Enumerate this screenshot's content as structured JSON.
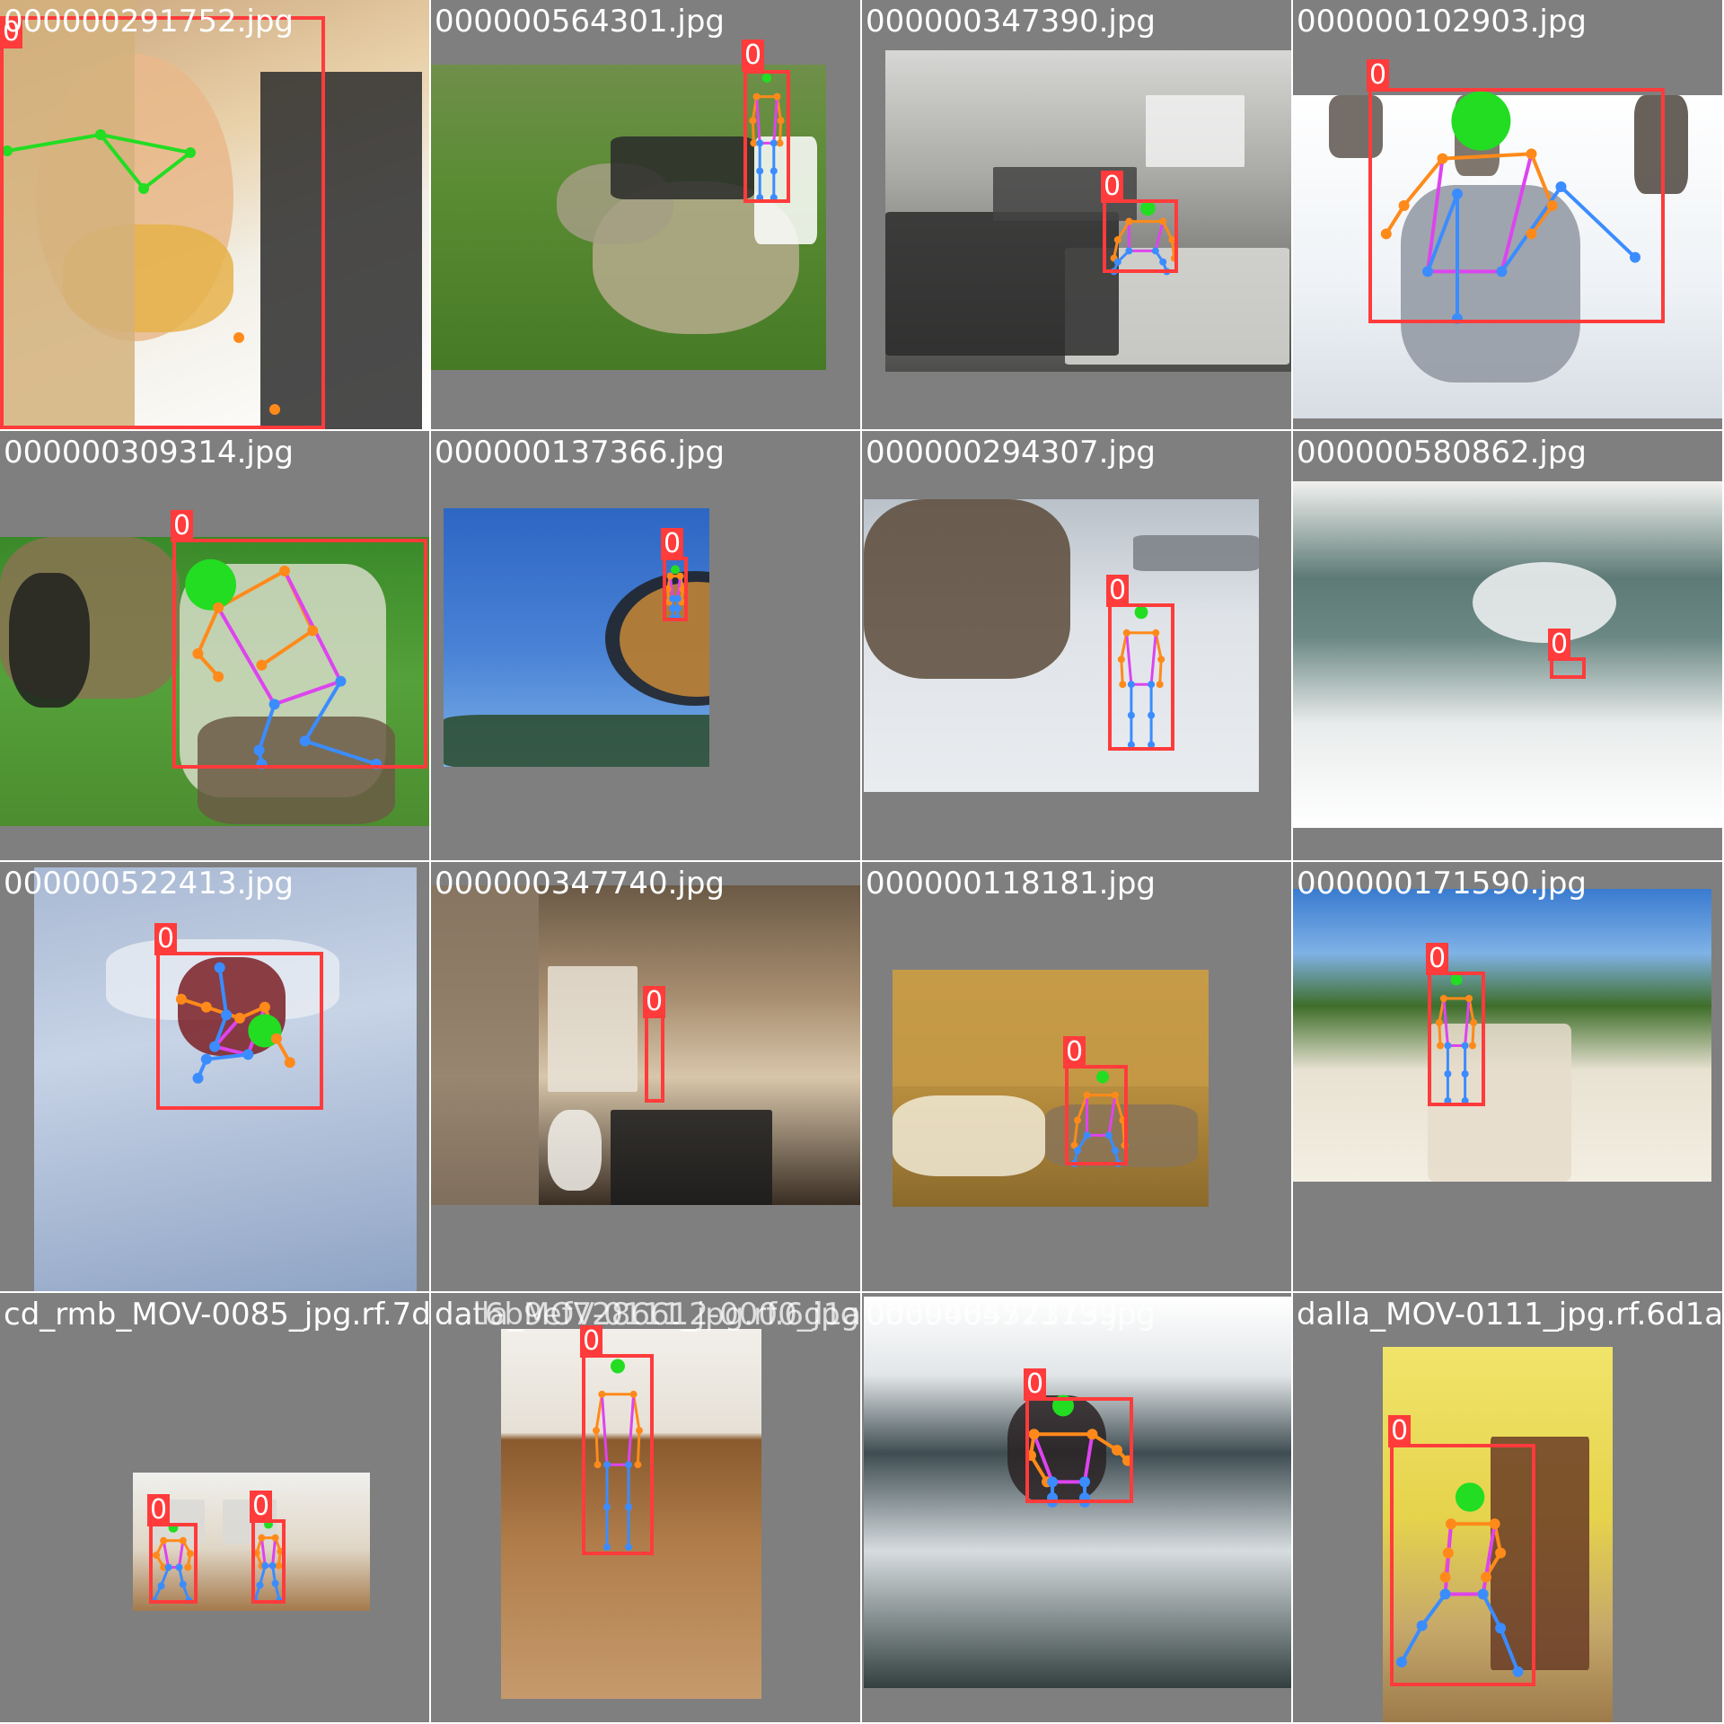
{
  "colors": {
    "box": "#ff3b3b",
    "label_bg": "#ff3b3b",
    "label_text": "#ffffff",
    "face_line": "#22dd22",
    "arm_line": "#ff8a1a",
    "torso_line": "#dd44ee",
    "leg_line": "#3b8cff",
    "letterbox": "#7f7f7f"
  },
  "tiles": [
    {
      "filename": "000000291752.jpg",
      "photo_theme": "child-eating-pizza",
      "detections": [
        {
          "class_label": "0"
        }
      ]
    },
    {
      "filename": "000000564301.jpg",
      "photo_theme": "sheep-on-grass",
      "detections": [
        {
          "class_label": "0"
        }
      ]
    },
    {
      "filename": "000000347390.jpg",
      "photo_theme": "computer-classroom",
      "detections": [
        {
          "class_label": "0"
        }
      ]
    },
    {
      "filename": "000000102903.jpg",
      "photo_theme": "snowboarder-sitting-in-snow",
      "detections": [
        {
          "class_label": "0"
        }
      ]
    },
    {
      "filename": "000000309314.jpg",
      "photo_theme": "man-shearing-sheep",
      "detections": [
        {
          "class_label": "0"
        }
      ]
    },
    {
      "filename": "000000137366.jpg",
      "photo_theme": "side-mirror-blue-sky",
      "detections": [
        {
          "class_label": "0"
        }
      ]
    },
    {
      "filename": "000000294307.jpg",
      "photo_theme": "skier-on-snowy-beach",
      "detections": [
        {
          "class_label": "0"
        }
      ]
    },
    {
      "filename": "000000580862.jpg",
      "photo_theme": "surfer-in-wave",
      "detections": [
        {
          "class_label": "0"
        }
      ]
    },
    {
      "filename": "000000522413.jpg",
      "photo_theme": "snowboarder-fallen",
      "detections": [
        {
          "class_label": "0"
        }
      ]
    },
    {
      "filename": "000000347740.jpg",
      "photo_theme": "bathroom-fisheye",
      "detections": [
        {
          "class_label": "0"
        }
      ]
    },
    {
      "filename": "000000118181.jpg",
      "photo_theme": "person-seated-in-restroom",
      "detections": [
        {
          "class_label": "0"
        }
      ]
    },
    {
      "filename": "000000171590.jpg",
      "photo_theme": "person-with-umbrella-on-road",
      "detections": [
        {
          "class_label": "0"
        }
      ]
    },
    {
      "filename": "cd_rmb_MOV-0085_jpg.rf.7d",
      "photo_theme": "two-dancers-studio",
      "detections": [
        {
          "class_label": "0"
        },
        {
          "class_label": "0"
        }
      ]
    },
    {
      "filename": "dalla_MOV-0111_jpg.rf.6d1a",
      "photo_theme": "dancer-wood-floor",
      "overlap_filename": "dat6b9ef7286612-0000_jpg",
      "detections": [
        {
          "class_label": "0"
        }
      ]
    },
    {
      "filename": "000000472179.jpg",
      "photo_theme": "person-in-ocean-waves",
      "overlap_filename": "0b69465573139",
      "detections": [
        {
          "class_label": "0"
        }
      ]
    },
    {
      "filename": "dalla_MOV-0111_jpg.rf.6d1a",
      "photo_theme": "dancer-yellow-room",
      "detections": [
        {
          "class_label": "0"
        }
      ]
    }
  ]
}
